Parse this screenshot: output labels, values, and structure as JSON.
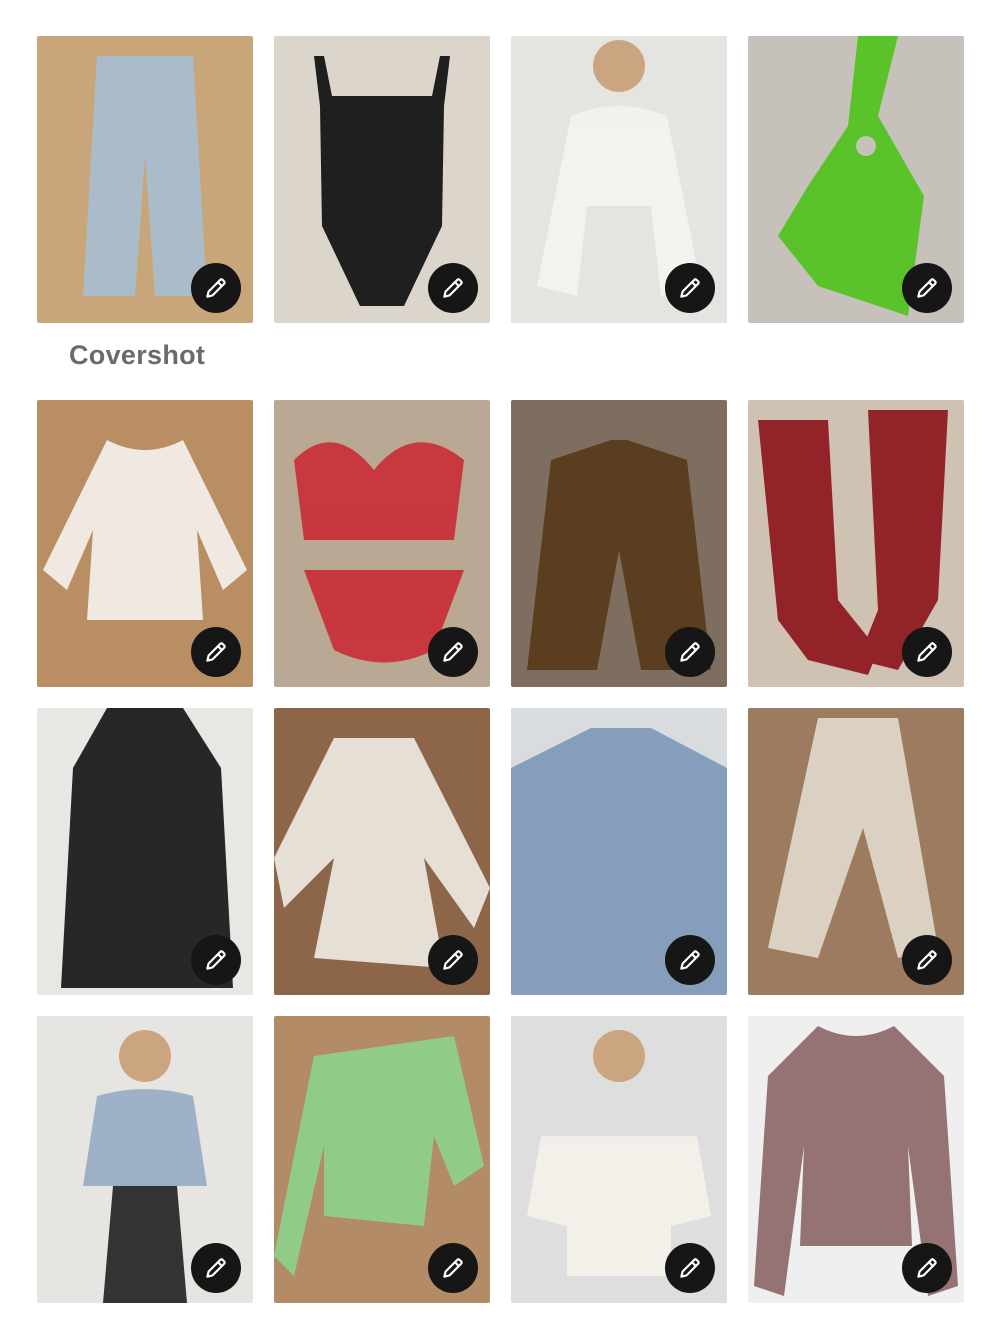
{
  "coverLabel": "Covershot",
  "editIconName": "pencil-icon",
  "items": [
    {
      "name": "light-wash-wide-leg-jeans",
      "bg": "#c9a679",
      "fg": "#a9bdcf"
    },
    {
      "name": "black-bodysuit",
      "bg": "#dcd5cb",
      "fg": "#151515"
    },
    {
      "name": "white-eyelet-tie-front-top",
      "bg": "#e4e4e1",
      "fg": "#f4f2ee"
    },
    {
      "name": "green-crochet-halter-top",
      "bg": "#c6c2bb",
      "fg": "#54c321"
    },
    {
      "name": "white-lace-tunic",
      "bg": "#b98e62",
      "fg": "#f1eee8"
    },
    {
      "name": "red-striped-ruffle-bikini",
      "bg": "#b9a893",
      "fg": "#c8333a"
    },
    {
      "name": "leopard-print-blazer",
      "bg": "#7e6e60",
      "fg": "#5a3a1c"
    },
    {
      "name": "red-western-boots",
      "bg": "#cfc2b2",
      "fg": "#8e1b22"
    },
    {
      "name": "black-sheer-long-coat",
      "bg": "#e9e7e4",
      "fg": "#1c1c1e"
    },
    {
      "name": "white-lace-mini-dress",
      "bg": "#8d6548",
      "fg": "#ebe6dd"
    },
    {
      "name": "denim-fringe-jacket",
      "bg": "#d9dcdf",
      "fg": "#7f9ab8"
    },
    {
      "name": "crochet-flare-pants",
      "bg": "#9c7b5e",
      "fg": "#ddd6c8"
    },
    {
      "name": "denim-jacket-zebra-pants-outfit",
      "bg": "#e7e5e1",
      "fg": "#9aaec4"
    },
    {
      "name": "green-knit-cardigan",
      "bg": "#b38b66",
      "fg": "#8fcf8c"
    },
    {
      "name": "white-lace-off-shoulder-top",
      "bg": "#dedede",
      "fg": "#f3f0ea"
    },
    {
      "name": "mauve-pleated-blouse",
      "bg": "#efefef",
      "fg": "#8f6a6c"
    }
  ]
}
